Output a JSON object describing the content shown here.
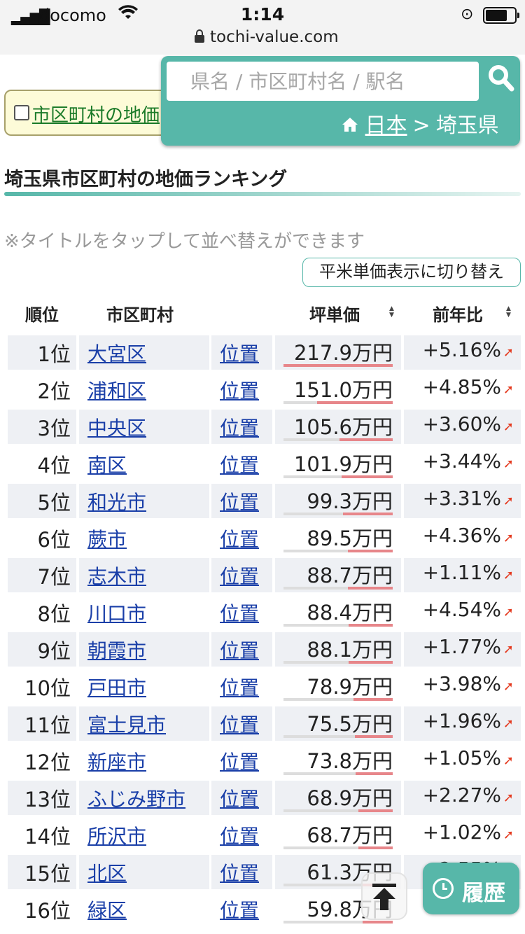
{
  "status_bar": {
    "carrier": "docomo",
    "time": "1:14",
    "url": "tochi-value.com"
  },
  "toggle": {
    "label": "市区町村の地価"
  },
  "search": {
    "placeholder": "県名 / 市区町村名 / 駅名",
    "breadcrumb_home": "日本",
    "breadcrumb_sep": ">",
    "breadcrumb_current": "埼玉県"
  },
  "page": {
    "title": "埼玉県市区町村の地価ランキング",
    "note": "※タイトルをタップして並べ替えができます",
    "unit_toggle": "平米単価表示に切り替え"
  },
  "table": {
    "headers": {
      "rank": "順位",
      "city": "市区町村",
      "price": "坪単価",
      "change": "前年比"
    },
    "max_price": 217.9,
    "rows": [
      {
        "rank": "1位",
        "city": "大宮区",
        "map": "位置",
        "price": "217.9万円",
        "price_value": 217.9,
        "change": "+5.16%"
      },
      {
        "rank": "2位",
        "city": "浦和区",
        "map": "位置",
        "price": "151.0万円",
        "price_value": 151.0,
        "change": "+4.85%"
      },
      {
        "rank": "3位",
        "city": "中央区",
        "map": "位置",
        "price": "105.6万円",
        "price_value": 105.6,
        "change": "+3.60%"
      },
      {
        "rank": "4位",
        "city": "南区",
        "map": "位置",
        "price": "101.9万円",
        "price_value": 101.9,
        "change": "+3.44%"
      },
      {
        "rank": "5位",
        "city": "和光市",
        "map": "位置",
        "price": "99.3万円",
        "price_value": 99.3,
        "change": "+3.31%"
      },
      {
        "rank": "6位",
        "city": "蕨市",
        "map": "位置",
        "price": "89.5万円",
        "price_value": 89.5,
        "change": "+4.36%"
      },
      {
        "rank": "7位",
        "city": "志木市",
        "map": "位置",
        "price": "88.7万円",
        "price_value": 88.7,
        "change": "+1.11%"
      },
      {
        "rank": "8位",
        "city": "川口市",
        "map": "位置",
        "price": "88.4万円",
        "price_value": 88.4,
        "change": "+4.54%"
      },
      {
        "rank": "9位",
        "city": "朝霞市",
        "map": "位置",
        "price": "88.1万円",
        "price_value": 88.1,
        "change": "+1.77%"
      },
      {
        "rank": "10位",
        "city": "戸田市",
        "map": "位置",
        "price": "78.9万円",
        "price_value": 78.9,
        "change": "+3.98%"
      },
      {
        "rank": "11位",
        "city": "富士見市",
        "map": "位置",
        "price": "75.5万円",
        "price_value": 75.5,
        "change": "+1.96%"
      },
      {
        "rank": "12位",
        "city": "新座市",
        "map": "位置",
        "price": "73.8万円",
        "price_value": 73.8,
        "change": "+1.05%"
      },
      {
        "rank": "13位",
        "city": "ふじみ野市",
        "map": "位置",
        "price": "68.9万円",
        "price_value": 68.9,
        "change": "+2.27%"
      },
      {
        "rank": "14位",
        "city": "所沢市",
        "map": "位置",
        "price": "68.7万円",
        "price_value": 68.7,
        "change": "+1.02%"
      },
      {
        "rank": "15位",
        "city": "北区",
        "map": "位置",
        "price": "61.3万円",
        "price_value": 61.3,
        "change": "+2.55%"
      },
      {
        "rank": "16位",
        "city": "緑区",
        "map": "位置",
        "price": "59.8万円",
        "price_value": 59.8,
        "change": "+1.62%"
      }
    ]
  },
  "floating": {
    "history_label": "履歴"
  },
  "colors": {
    "accent": "#57b7a9",
    "link": "#1a3fa8",
    "bar": "#e7868a",
    "up_arrow": "#e4391e"
  }
}
